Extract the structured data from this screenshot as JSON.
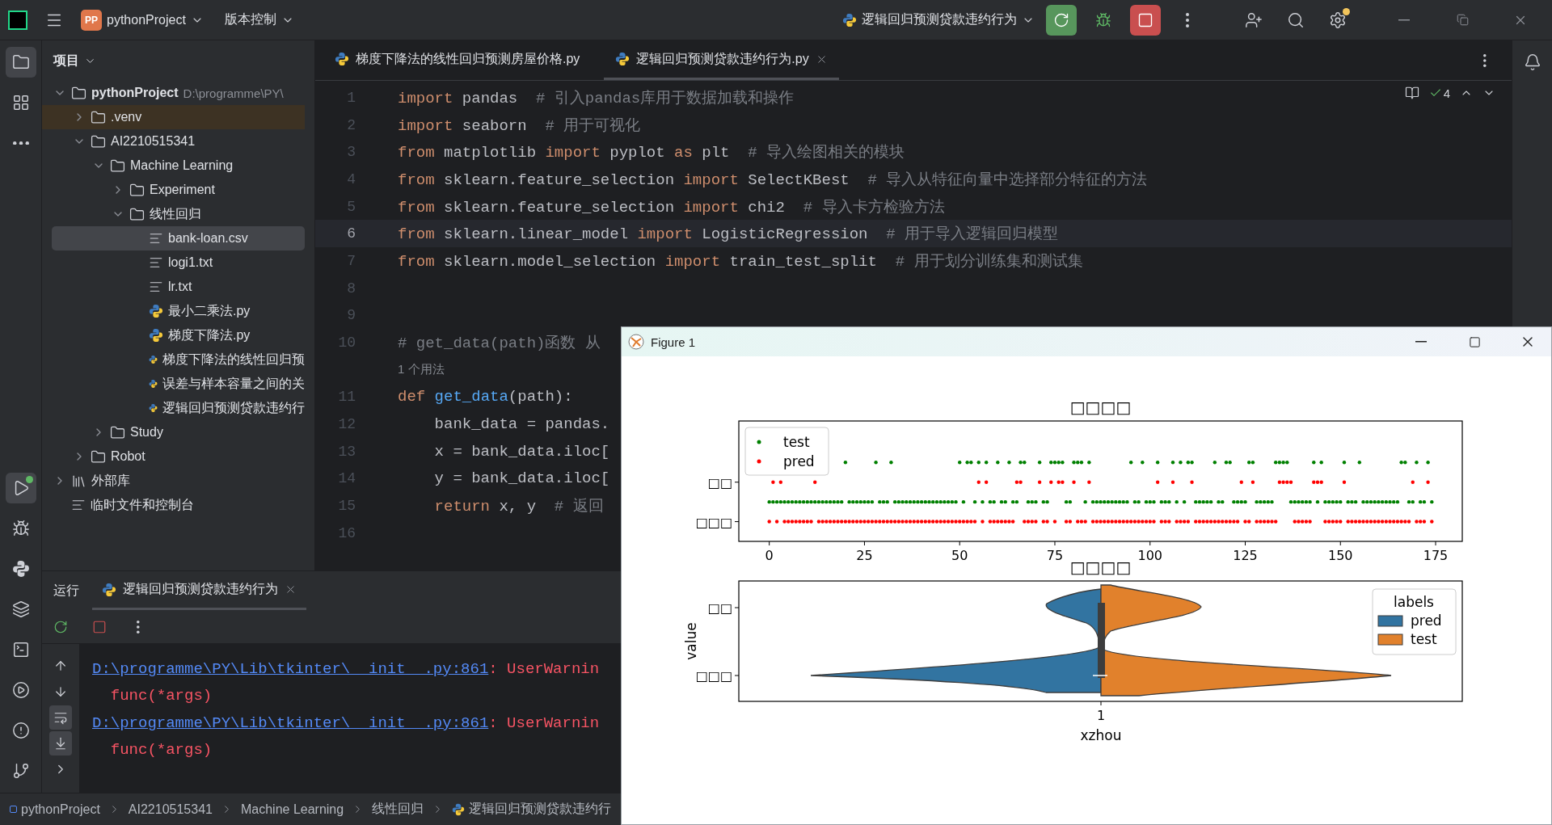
{
  "title_bar": {
    "project_badge": "PP",
    "project": "pythonProject",
    "vcs": "版本控制",
    "run_config": "逻辑回归预测贷款违约行为",
    "settings_badge": true
  },
  "left_toolbar_top": [
    {
      "kind": "folder",
      "selected": true,
      "running": false
    },
    {
      "kind": "structure",
      "selected": false,
      "running": false
    },
    {
      "kind": "more",
      "selected": false,
      "running": false
    }
  ],
  "left_toolbar_bottom": [
    {
      "kind": "run",
      "selected": true,
      "running": true
    },
    {
      "kind": "debug",
      "selected": false,
      "running": false
    },
    {
      "kind": "python",
      "selected": false,
      "running": false
    },
    {
      "kind": "layers",
      "selected": false,
      "running": false
    },
    {
      "kind": "terminal",
      "selected": false,
      "running": false
    },
    {
      "kind": "services",
      "selected": false,
      "running": false
    },
    {
      "kind": "problems",
      "selected": false,
      "running": false
    },
    {
      "kind": "git",
      "selected": false,
      "running": false
    }
  ],
  "project_panel": {
    "title": "项目",
    "tree": [
      {
        "label": "pythonProject",
        "kind": "folder",
        "path": "D:\\programme\\PY\\",
        "expanded": true,
        "selected": false,
        "children": [
          {
            "label": ".venv",
            "kind": "excluded_folder",
            "expanded": false,
            "selected": false
          },
          {
            "label": "AI2210515341",
            "kind": "folder",
            "expanded": true,
            "selected": false,
            "children": [
              {
                "label": "Machine Learning",
                "kind": "folder",
                "expanded": true,
                "selected": false,
                "children": [
                  {
                    "label": "Experiment",
                    "kind": "folder",
                    "expanded": false,
                    "selected": false
                  },
                  {
                    "label": "线性回归",
                    "kind": "folder",
                    "expanded": true,
                    "selected": false,
                    "children": [
                      {
                        "label": "bank-loan.csv",
                        "kind": "text",
                        "selected": true
                      },
                      {
                        "label": "logi1.txt",
                        "kind": "text",
                        "selected": false
                      },
                      {
                        "label": "lr.txt",
                        "kind": "text",
                        "selected": false
                      },
                      {
                        "label": "最小二乘法.py",
                        "kind": "python",
                        "selected": false
                      },
                      {
                        "label": "梯度下降法.py",
                        "kind": "python",
                        "selected": false
                      },
                      {
                        "label": "梯度下降法的线性回归预",
                        "kind": "python",
                        "selected": false
                      },
                      {
                        "label": "误差与样本容量之间的关",
                        "kind": "python",
                        "selected": false
                      },
                      {
                        "label": "逻辑回归预测贷款违约行",
                        "kind": "python",
                        "selected": false
                      }
                    ]
                  }
                ]
              },
              {
                "label": "Study",
                "kind": "folder",
                "expanded": false,
                "selected": false
              }
            ]
          },
          {
            "label": "Robot",
            "kind": "folder",
            "expanded": false,
            "selected": false
          }
        ]
      },
      {
        "label": "外部库",
        "kind": "library",
        "expanded": false,
        "selected": false
      },
      {
        "label": "临时文件和控制台",
        "kind": "scratch",
        "selected": false
      }
    ]
  },
  "editor": {
    "tabs": [
      {
        "label": "梯度下降法的线性回归预测房屋价格.py",
        "selected": false
      },
      {
        "label": "逻辑回归预测贷款违约行为.py",
        "selected": true
      }
    ],
    "inspections": "4",
    "lines": [
      {
        "kind": "code",
        "number": "1",
        "current": false,
        "tokens": [
          {
            "kind": "keyword",
            "text": "import"
          },
          {
            "kind": "plain",
            "text": " pandas  "
          },
          {
            "kind": "comment",
            "text": "# 引入pandas库用于数据加载和操作"
          }
        ]
      },
      {
        "kind": "code",
        "number": "2",
        "current": false,
        "tokens": [
          {
            "kind": "keyword",
            "text": "import"
          },
          {
            "kind": "plain",
            "text": " seaborn  "
          },
          {
            "kind": "comment",
            "text": "# 用于可视化"
          }
        ]
      },
      {
        "kind": "code",
        "number": "3",
        "current": false,
        "tokens": [
          {
            "kind": "keyword",
            "text": "from"
          },
          {
            "kind": "plain",
            "text": " matplotlib "
          },
          {
            "kind": "keyword",
            "text": "import"
          },
          {
            "kind": "plain",
            "text": " pyplot "
          },
          {
            "kind": "keyword",
            "text": "as"
          },
          {
            "kind": "plain",
            "text": " plt  "
          },
          {
            "kind": "comment",
            "text": "# 导入绘图相关的模块"
          }
        ]
      },
      {
        "kind": "code",
        "number": "4",
        "current": false,
        "tokens": [
          {
            "kind": "keyword",
            "text": "from"
          },
          {
            "kind": "plain",
            "text": " sklearn.feature_selection "
          },
          {
            "kind": "keyword",
            "text": "import"
          },
          {
            "kind": "plain",
            "text": " SelectKBest  "
          },
          {
            "kind": "comment",
            "text": "# 导入从特征向量中选择部分特征的方法"
          }
        ]
      },
      {
        "kind": "code",
        "number": "5",
        "current": false,
        "tokens": [
          {
            "kind": "keyword",
            "text": "from"
          },
          {
            "kind": "plain",
            "text": " sklearn.feature_selection "
          },
          {
            "kind": "keyword",
            "text": "import"
          },
          {
            "kind": "plain",
            "text": " chi2  "
          },
          {
            "kind": "comment",
            "text": "# 导入卡方检验方法"
          }
        ]
      },
      {
        "kind": "code",
        "number": "6",
        "current": true,
        "tokens": [
          {
            "kind": "keyword",
            "text": "from"
          },
          {
            "kind": "plain",
            "text": " sklearn.linear_model "
          },
          {
            "kind": "keyword",
            "text": "import"
          },
          {
            "kind": "plain",
            "text": " LogisticRegression  "
          },
          {
            "kind": "comment",
            "text": "# 用于导入逻辑回归模型"
          }
        ]
      },
      {
        "kind": "code",
        "number": "7",
        "current": false,
        "tokens": [
          {
            "kind": "keyword",
            "text": "from"
          },
          {
            "kind": "plain",
            "text": " sklearn.model_selection "
          },
          {
            "kind": "keyword",
            "text": "import"
          },
          {
            "kind": "plain",
            "text": " train_test_split  "
          },
          {
            "kind": "comment",
            "text": "# 用于划分训练集和测试集"
          }
        ]
      },
      {
        "kind": "code",
        "number": "8",
        "current": false
      },
      {
        "kind": "code",
        "number": "9",
        "current": false
      },
      {
        "kind": "code",
        "number": "10",
        "current": false,
        "tokens": [
          {
            "kind": "comment",
            "text": "# get_data(path)函数 从"
          }
        ]
      },
      {
        "kind": "hint",
        "text": "1 个用法"
      },
      {
        "kind": "code",
        "number": "11",
        "current": false,
        "tokens": [
          {
            "kind": "keyword",
            "text": "def"
          },
          {
            "kind": "function",
            "text": " get_data"
          },
          {
            "kind": "plain",
            "text": "(path):"
          }
        ]
      },
      {
        "kind": "code",
        "number": "12",
        "current": false,
        "tokens": [
          {
            "kind": "plain",
            "text": "    bank_data = pandas."
          }
        ]
      },
      {
        "kind": "code",
        "number": "13",
        "current": false,
        "tokens": [
          {
            "kind": "plain",
            "text": "    x = bank_data.iloc["
          }
        ]
      },
      {
        "kind": "code",
        "number": "14",
        "current": false,
        "tokens": [
          {
            "kind": "plain",
            "text": "    y = bank_data.iloc["
          }
        ]
      },
      {
        "kind": "code",
        "number": "15",
        "current": false,
        "tokens": [
          {
            "kind": "keyword",
            "text": "    return"
          },
          {
            "kind": "plain",
            "text": " x, y  "
          },
          {
            "kind": "comment",
            "text": "# 返回"
          }
        ]
      },
      {
        "kind": "code",
        "number": "16",
        "current": false
      }
    ]
  },
  "run_panel": {
    "label": "运行",
    "tab": {
      "label": "逻辑回归预测贷款违约行为",
      "selected": true
    },
    "side_buttons": [
      {
        "kind": "up",
        "selected": false
      },
      {
        "kind": "down",
        "selected": false
      },
      {
        "kind": "wrap",
        "selected": true
      },
      {
        "kind": "scroll_end",
        "selected": true
      },
      {
        "kind": "expand",
        "selected": false
      }
    ],
    "console": [
      {
        "kind": "warning",
        "link": "D:\\programme\\PY\\Lib\\tkinter\\__init__.py:861",
        "text": ": UserWarnin"
      },
      {
        "kind": "error",
        "text": "  func(*args)"
      },
      {
        "kind": "warning",
        "link": "D:\\programme\\PY\\Lib\\tkinter\\__init__.py:861",
        "text": ": UserWarnin"
      },
      {
        "kind": "error",
        "text": "  func(*args)"
      }
    ]
  },
  "status_bar": {
    "breadcrumbs": [
      {
        "label": "pythonProject",
        "kind": "project"
      },
      {
        "label": "AI2210515341",
        "kind": "folder"
      },
      {
        "label": "Machine Learning",
        "kind": "folder"
      },
      {
        "label": "线性回归",
        "kind": "folder"
      },
      {
        "label": "逻辑回归预测贷款违约行",
        "kind": "python"
      }
    ]
  },
  "figure": {
    "title": "Figure 1",
    "scatter": {
      "title": "□□□□",
      "y_labels": [
        "□□",
        "□□□"
      ],
      "xticks": [
        "0",
        "25",
        "50",
        "75",
        "100",
        "125",
        "150",
        "175"
      ],
      "legend": [
        {
          "label": "test",
          "color": "#008000"
        },
        {
          "label": "pred",
          "color": "#ff0000"
        }
      ]
    },
    "violin": {
      "title": "□□□□",
      "ylabel": "value",
      "yticks": [
        "□□",
        "□□□"
      ],
      "xtick": "1",
      "xlabel": "xzhou",
      "legend": {
        "title": "labels",
        "items": [
          {
            "label": "pred",
            "color": "#3274a1"
          },
          {
            "label": "test",
            "color": "#e1812c"
          }
        ]
      }
    }
  }
}
